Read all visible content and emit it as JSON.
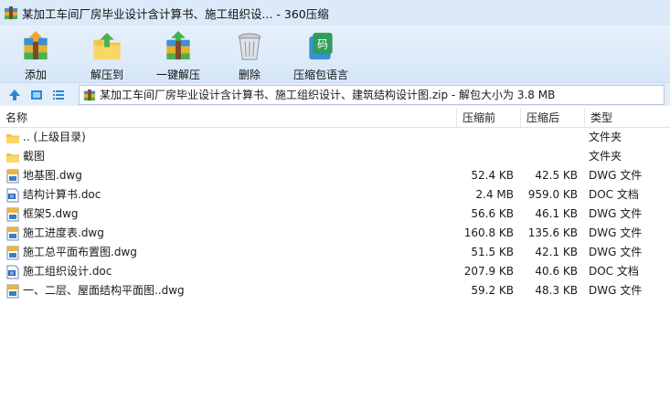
{
  "window": {
    "title": "某加工车间厂房毕业设计含计算书、施工组织设... - 360压缩"
  },
  "toolbar": {
    "add_label": "添加",
    "extract_label": "解压到",
    "one_click_label": "一键解压",
    "delete_label": "删除",
    "language_label": "压缩包语言"
  },
  "address": {
    "path": "某加工车间厂房毕业设计含计算书、施工组织设计、建筑结构设计图.zip - 解包大小为 3.8 MB"
  },
  "columns": {
    "name": "名称",
    "size": "压缩前",
    "compressed": "压缩后",
    "type": "类型"
  },
  "files": [
    {
      "name": ".. (上级目录)",
      "size": "",
      "compressed": "",
      "type": "文件夹",
      "icon": "folder-icon"
    },
    {
      "name": "截图",
      "size": "",
      "compressed": "",
      "type": "文件夹",
      "icon": "folder-icon"
    },
    {
      "name": "地基图.dwg",
      "size": "52.4 KB",
      "compressed": "42.5 KB",
      "type": "DWG 文件",
      "icon": "dwg-file-icon"
    },
    {
      "name": "结构计算书.doc",
      "size": "2.4 MB",
      "compressed": "959.0 KB",
      "type": "DOC 文档",
      "icon": "doc-file-icon"
    },
    {
      "name": "框架5.dwg",
      "size": "56.6 KB",
      "compressed": "46.1 KB",
      "type": "DWG 文件",
      "icon": "dwg-file-icon"
    },
    {
      "name": "施工进度表.dwg",
      "size": "160.8 KB",
      "compressed": "135.6 KB",
      "type": "DWG 文件",
      "icon": "dwg-file-icon"
    },
    {
      "name": "施工总平面布置图.dwg",
      "size": "51.5 KB",
      "compressed": "42.1 KB",
      "type": "DWG 文件",
      "icon": "dwg-file-icon"
    },
    {
      "name": "施工组织设计.doc",
      "size": "207.9 KB",
      "compressed": "40.6 KB",
      "type": "DOC 文档",
      "icon": "doc-file-icon"
    },
    {
      "name": "一、二层、屋面结构平面图..dwg",
      "size": "59.2 KB",
      "compressed": "48.3 KB",
      "type": "DWG 文件",
      "icon": "dwg-file-icon"
    }
  ]
}
